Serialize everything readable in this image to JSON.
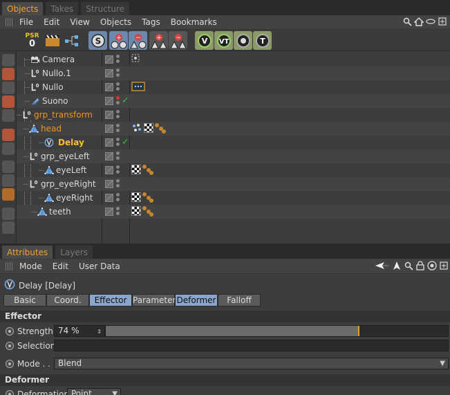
{
  "object_manager": {
    "tabs": [
      "Objects",
      "Takes",
      "Structure"
    ],
    "active_tab": "Objects",
    "menu": [
      "File",
      "Edit",
      "View",
      "Objects",
      "Tags",
      "Bookmarks"
    ],
    "psr_label": "PSR",
    "psr_value": "0",
    "objects": [
      {
        "name": "Camera",
        "icon": "camera-icon",
        "style": "white"
      },
      {
        "name": "Nullo.1",
        "icon": "null-icon",
        "style": "white"
      },
      {
        "name": "Nullo",
        "icon": "null-icon",
        "style": "white"
      },
      {
        "name": "Suono",
        "icon": "speaker-icon",
        "style": "white"
      },
      {
        "name": "grp_transform",
        "icon": "null-icon",
        "style": "orange"
      },
      {
        "name": "head",
        "icon": "polygon-icon",
        "style": "orange"
      },
      {
        "name": "Delay",
        "icon": "delay-effector-icon",
        "style": "yellow"
      },
      {
        "name": "grp_eyeLeft",
        "icon": "null-icon",
        "style": "white"
      },
      {
        "name": "eyeLeft",
        "icon": "polygon-icon",
        "style": "white"
      },
      {
        "name": "grp_eyeRight",
        "icon": "null-icon",
        "style": "white"
      },
      {
        "name": "eyeRight",
        "icon": "polygon-icon",
        "style": "white"
      },
      {
        "name": "teeth",
        "icon": "polygon-icon",
        "style": "white"
      }
    ]
  },
  "attributes": {
    "tabs": [
      "Attributes",
      "Layers"
    ],
    "active_tab": "Attributes",
    "menu": [
      "Mode",
      "Edit",
      "User Data"
    ],
    "object_title": "Delay [Delay]",
    "param_tabs": [
      {
        "label": "Basic",
        "active": false
      },
      {
        "label": "Coord.",
        "active": false
      },
      {
        "label": "Effector",
        "active": true
      },
      {
        "label": "Parameter",
        "active": false
      },
      {
        "label": "Deformer",
        "active": true
      },
      {
        "label": "Falloff",
        "active": false
      }
    ],
    "effector_section": "Effector",
    "strength_label": "Strength",
    "strength_value": "74 %",
    "strength_fraction": 0.74,
    "selection_label": "Selection",
    "mode_label": "Mode . . .",
    "mode_value": "Blend",
    "deformer_section": "Deformer",
    "deformation_label": "Deformation",
    "deformation_value": "Point"
  },
  "colors": {
    "accent_orange": "#f0a030",
    "tab_blue": "#8aa6cc",
    "check_green": "#3ec23e"
  }
}
